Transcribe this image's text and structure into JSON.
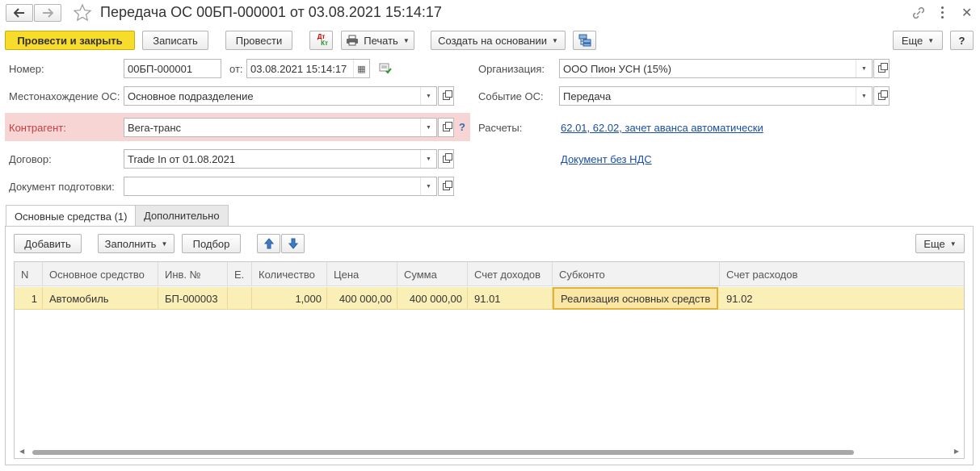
{
  "window": {
    "title": "Передача ОС 00БП-000001 от 03.08.2021 15:14:17"
  },
  "toolbar": {
    "post_and_close": "Провести и закрыть",
    "save": "Записать",
    "post": "Провести",
    "dt_kt_top": "Дт",
    "dt_kt_bottom": "Кт",
    "print": "Печать",
    "create_based_on": "Создать на основании",
    "more": "Еще",
    "help": "?"
  },
  "form": {
    "number_label": "Номер:",
    "number_value": "00БП-000001",
    "date_label": "от:",
    "date_value": "03.08.2021 15:14:17",
    "location_label": "Местонахождение ОС:",
    "location_value": "Основное подразделение",
    "counterparty_label": "Контрагент:",
    "counterparty_value": "Вега-транс",
    "counterparty_hint": "?",
    "contract_label": "Договор:",
    "contract_value": "Trade In от 01.08.2021",
    "prep_doc_label": "Документ подготовки:",
    "prep_doc_value": "",
    "organization_label": "Организация:",
    "organization_value": "ООО Пион УСН (15%)",
    "event_label": "Событие ОС:",
    "event_value": "Передача",
    "settlements_label": "Расчеты:",
    "settlements_link": "62.01, 62.02, зачет аванса автоматически",
    "vat_link": "Документ без НДС"
  },
  "tabs": [
    {
      "label": "Основные средства (1)"
    },
    {
      "label": "Дополнительно"
    }
  ],
  "table_toolbar": {
    "add": "Добавить",
    "fill": "Заполнить",
    "select": "Подбор",
    "more": "Еще"
  },
  "table": {
    "columns": [
      "N",
      "Основное средство",
      "Инв. №",
      "Е.",
      "Количество",
      "Цена",
      "Сумма",
      "Счет доходов",
      "Субконто",
      "Счет расходов"
    ],
    "rows": [
      {
        "n": "1",
        "asset": "Автомобиль",
        "inv": "БП-000003",
        "unit": "",
        "qty": "1,000",
        "price": "400 000,00",
        "sum": "400 000,00",
        "income_account": "91.01",
        "subconto": "Реализация основных средств",
        "expense_account": "91.02"
      }
    ]
  },
  "colors": {
    "primary_button": "#f7dc2b",
    "error_highlight": "#f7d5d5",
    "link": "#1a4ea3",
    "selected_row": "#fbefb8"
  }
}
